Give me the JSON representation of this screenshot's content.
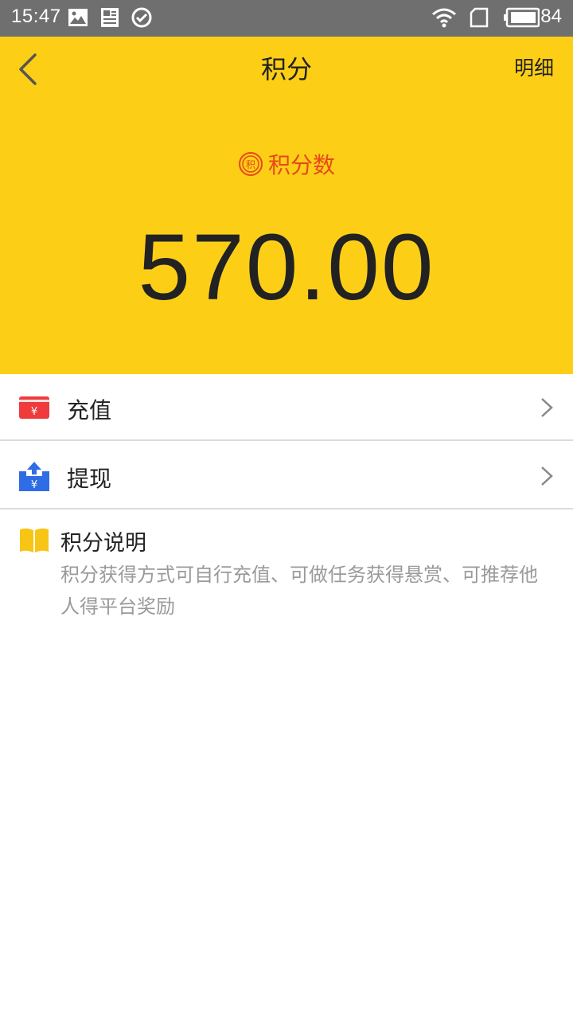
{
  "status_bar": {
    "time": "15:47",
    "icons": [
      "image-icon",
      "news-icon",
      "check-circle-icon",
      "wifi-icon",
      "sim-card-icon",
      "battery-icon"
    ],
    "battery_level": "84"
  },
  "header": {
    "title": "积分",
    "detail_label": "明细",
    "points_label": "积分数",
    "points_value": "570.00",
    "background_color": "#fccf16",
    "accent_color": "#e8471c"
  },
  "menu": {
    "recharge_label": "充值",
    "withdraw_label": "提现"
  },
  "description": {
    "title": "积分说明",
    "text": "积分获得方式可自行充值、可做任务获得悬赏、可推荐他人得平台奖励"
  }
}
